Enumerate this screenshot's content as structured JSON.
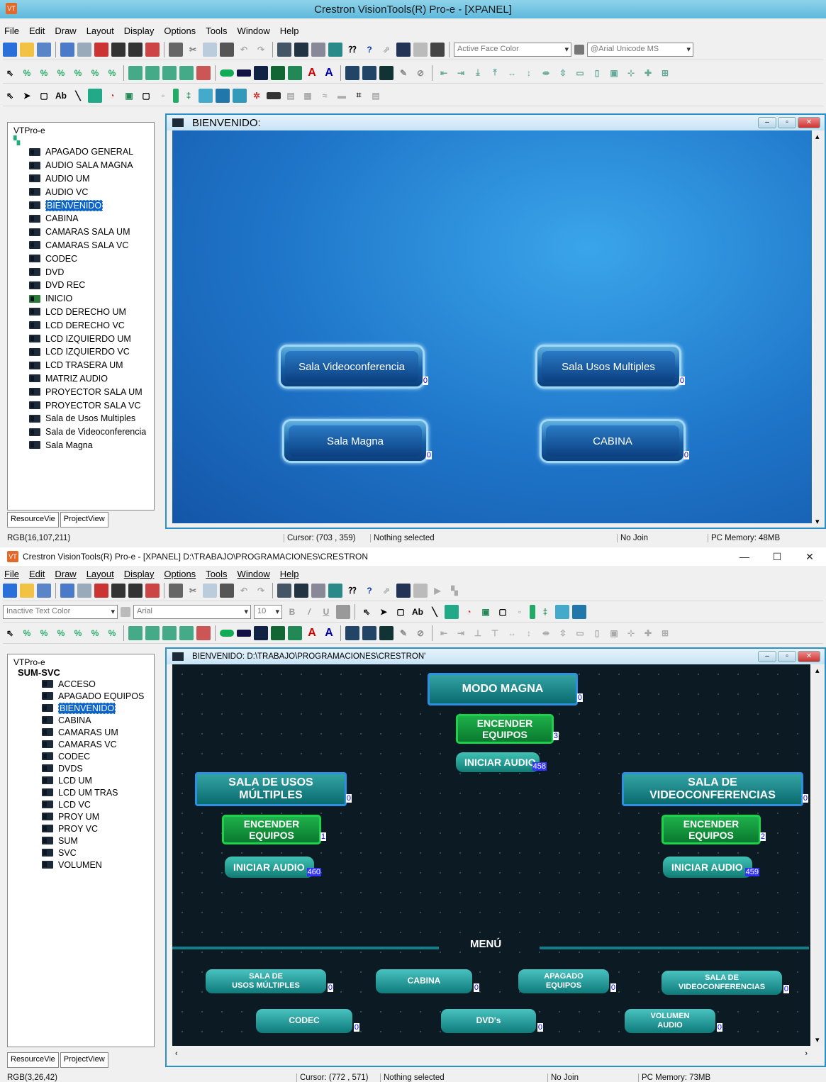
{
  "window1": {
    "title": "Crestron VisionTools(R) Pro-e - [XPANEL]",
    "menu": [
      "File",
      "Edit",
      "Draw",
      "Layout",
      "Display",
      "Options",
      "Tools",
      "Window",
      "Help"
    ],
    "toolbar": {
      "face_color": "Active Face Color",
      "font": "@Arial Unicode MS"
    },
    "tree_root": "VTPro-e",
    "tree_items": [
      {
        "label": "APAGADO GENERAL"
      },
      {
        "label": "AUDIO SALA MAGNA"
      },
      {
        "label": "AUDIO UM"
      },
      {
        "label": "AUDIO VC"
      },
      {
        "label": "BIENVENIDO",
        "selected": true
      },
      {
        "label": "CABINA"
      },
      {
        "label": "CAMARAS SALA UM"
      },
      {
        "label": "CAMARAS SALA VC"
      },
      {
        "label": "CODEC"
      },
      {
        "label": "DVD"
      },
      {
        "label": "DVD REC"
      },
      {
        "label": "INICIO",
        "icon": "green"
      },
      {
        "label": "LCD DERECHO UM"
      },
      {
        "label": "LCD DERECHO VC"
      },
      {
        "label": "LCD IZQUIERDO UM"
      },
      {
        "label": "LCD IZQUIERDO VC"
      },
      {
        "label": "LCD TRASERA UM"
      },
      {
        "label": "MATRIZ AUDIO"
      },
      {
        "label": "PROYECTOR SALA UM"
      },
      {
        "label": "PROYECTOR SALA VC"
      },
      {
        "label": "Sala de Usos Multiples"
      },
      {
        "label": "Sala de Videoconferencia"
      },
      {
        "label": "Sala Magna"
      }
    ],
    "tabs": [
      "ResourceVie",
      "ProjectView"
    ],
    "panel_title": "BIENVENIDO:",
    "buttons": [
      {
        "label": "Sala Videoconferencia",
        "join": "0"
      },
      {
        "label": "Sala Usos Multiples",
        "join": "0"
      },
      {
        "label": "Sala Magna",
        "join": "0"
      },
      {
        "label": "CABINA",
        "join": "0"
      }
    ],
    "status": {
      "rgb": "RGB(16,107,211)",
      "cursor": "Cursor: (703 , 359)",
      "selection": "Nothing selected",
      "join": "No Join",
      "memory": "PC Memory: 48MB"
    }
  },
  "window2": {
    "title": "Crestron VisionTools(R) Pro-e - [XPANEL] D:\\TRABAJO\\PROGRAMACIONES\\CRESTRON",
    "menu": [
      "File",
      "Edit",
      "Draw",
      "Layout",
      "Display",
      "Options",
      "Tools",
      "Window",
      "Help"
    ],
    "toolbar": {
      "text_color": "Inactive Text Color",
      "font": "Arial",
      "size": "10"
    },
    "tree_root": "VTPro-e",
    "tree_project": "SUM-SVC",
    "tree_items": [
      {
        "label": "ACCESO"
      },
      {
        "label": "APAGADO EQUIPOS"
      },
      {
        "label": "BIENVENIDO",
        "selected": true
      },
      {
        "label": "CABINA"
      },
      {
        "label": "CAMARAS UM"
      },
      {
        "label": "CAMARAS VC"
      },
      {
        "label": "CODEC"
      },
      {
        "label": "DVDS"
      },
      {
        "label": "LCD UM"
      },
      {
        "label": "LCD UM TRAS"
      },
      {
        "label": "LCD VC"
      },
      {
        "label": "PROY UM"
      },
      {
        "label": "PROY VC"
      },
      {
        "label": "SUM"
      },
      {
        "label": "SVC"
      },
      {
        "label": "VOLUMEN"
      }
    ],
    "tabs": [
      "ResourceVie",
      "ProjectView"
    ],
    "panel_title": "BIENVENIDO: D:\\TRABAJO\\PROGRAMACIONES\\CRESTRON'",
    "magna": {
      "title": "MODO MAGNA",
      "title_join": "0",
      "power": "ENCENDER\nEQUIPOS",
      "power_join": "3",
      "audio": "INICIAR AUDIO",
      "audio_join": "458"
    },
    "sum": {
      "title": "SALA DE USOS\nMÚLTIPLES",
      "title_join": "0",
      "power": "ENCENDER\nEQUIPOS",
      "power_join": "1",
      "audio": "INICIAR AUDIO",
      "audio_join": "460"
    },
    "svc": {
      "title": "SALA DE\nVIDEOCONFERENCIAS",
      "title_join": "0",
      "power": "ENCENDER\nEQUIPOS",
      "power_join": "2",
      "audio": "INICIAR AUDIO",
      "audio_join": "459"
    },
    "menu_label": "MENÚ",
    "menu_buttons": [
      {
        "label": "SALA DE\nUSOS MÚLTIPLES",
        "join": "0"
      },
      {
        "label": "CABINA",
        "join": "0"
      },
      {
        "label": "APAGADO\nEQUIPOS",
        "join": "0"
      },
      {
        "label": "SALA DE\nVIDEOCONFERENCIAS",
        "join": "0"
      },
      {
        "label": "CODEC",
        "join": "0"
      },
      {
        "label": "DVD's",
        "join": "0"
      },
      {
        "label": "VOLUMEN\nAUDIO",
        "join": "0"
      }
    ],
    "status": {
      "rgb": "RGB(3,26,42)",
      "cursor": "Cursor: (772 , 571)",
      "selection": "Nothing selected",
      "join": "No Join",
      "memory": "PC Memory: 73MB"
    }
  }
}
